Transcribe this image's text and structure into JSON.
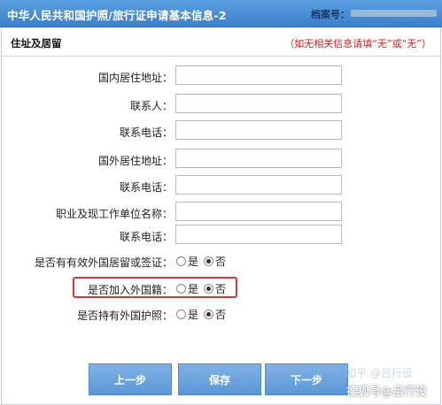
{
  "header": {
    "title": "中华人民共和国护照/旅行证申请基本信息-2",
    "file_no_label": "档案号："
  },
  "section": {
    "title": "住址及居留",
    "note": "（如无相关信息请填“无”或“无”）"
  },
  "fields": [
    {
      "label": "国内居住地址：",
      "value": ""
    },
    {
      "label": "联系人：",
      "value": ""
    },
    {
      "label": "联系电话：",
      "value": ""
    },
    {
      "label": "国外居住地址：",
      "value": ""
    },
    {
      "label": "联系电话：",
      "value": ""
    },
    {
      "label": "职业及现工作单位名称：",
      "value": ""
    },
    {
      "label": "联系电话：",
      "value": ""
    }
  ],
  "radios": [
    {
      "label": "是否有有效外国居留或签证：",
      "yes": "是",
      "no": "否",
      "selected": "否"
    },
    {
      "label": "是否加入外国籍：",
      "yes": "是",
      "no": "否",
      "selected": "否"
    },
    {
      "label": "是否持有外国护照：",
      "yes": "是",
      "no": "否",
      "selected": "否"
    }
  ],
  "buttons": {
    "prev": "上一步",
    "save": "保存",
    "next": "下一步"
  },
  "watermark": {
    "text": "搜狐号@吕行设",
    "faint": "知乎 @吕行设"
  }
}
